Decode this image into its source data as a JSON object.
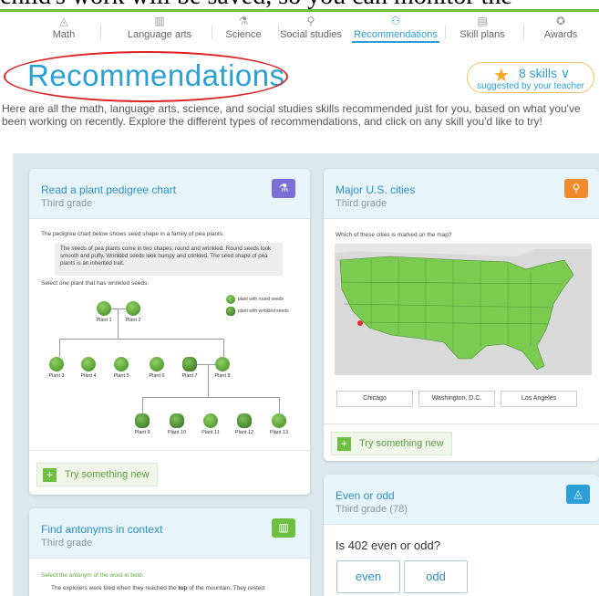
{
  "top_cut_text": "child's work will be saved, so you can monitor the",
  "nav": [
    {
      "label": "Math",
      "icon": "◬"
    },
    {
      "label": "Language arts",
      "icon": "▥"
    },
    {
      "label": "Science",
      "icon": "⚗"
    },
    {
      "label": "Social studies",
      "icon": "⚲"
    },
    {
      "label": "Recommendations",
      "icon": "⚇"
    },
    {
      "label": "Skill plans",
      "icon": "▤"
    },
    {
      "label": "Awards",
      "icon": "✪"
    }
  ],
  "page_title": "Recommendations",
  "skills_pill": {
    "count_label": "8 skills ∨",
    "sub": "suggested by your teacher"
  },
  "intro": "Here are all the math, language arts, science, and social studies skills recommended just for you, based on what you've been working on recently. Explore the different types of recommendations, and click on any skill you'd like to try!",
  "card1": {
    "title": "Read a plant pedigree chart",
    "grade": "Third grade",
    "badge_icon": "⚗",
    "badge_color": "#7b6fd6",
    "lead": "The pedigree chart below shows seed shape in a family of pea plants.",
    "box_text": "The seeds of pea plants come in two shapes: round and wrinkled. Round seeds look smooth and puffy. Wrinkled seeds look bumpy and crinkled. The seed shape of pea plants is an inherited trait.",
    "question": "Select one plant that has wrinkled seeds.",
    "legend_round": "plant with round seeds",
    "legend_wrinkled": "plant with wrinkled seeds",
    "plants": [
      {
        "label": "Plant 1"
      },
      {
        "label": "Plant 2"
      },
      {
        "label": "Plant 3"
      },
      {
        "label": "Plant 4"
      },
      {
        "label": "Plant 5"
      },
      {
        "label": "Plant 6"
      },
      {
        "label": "Plant 7"
      },
      {
        "label": "Plant 8"
      },
      {
        "label": "Plant 9"
      },
      {
        "label": "Plant 10"
      },
      {
        "label": "Plant 11"
      },
      {
        "label": "Plant 12"
      },
      {
        "label": "Plant 13"
      }
    ],
    "try_label": "Try something new"
  },
  "card2": {
    "title": "Major U.S. cities",
    "grade": "Third grade",
    "badge_icon": "⚲",
    "badge_color": "#f08a2c",
    "question": "Which of these cities is marked on the map?",
    "options": [
      "Chicago",
      "Washington, D.C.",
      "Los Angeles"
    ],
    "try_label": "Try something new"
  },
  "card3": {
    "title": "Find antonyms in context",
    "grade": "Third grade",
    "badge_icon": "▥",
    "badge_color": "#6cbf3f",
    "instruction": "Select the antonym of the word in bold.",
    "sentence_pre": "The explorers were tired when they reached the ",
    "sentence_bold": "top",
    "sentence_post": " of the mountain. They rested"
  },
  "card4": {
    "title": "Even or odd",
    "grade": "Third grade (78)",
    "badge_icon": "◬",
    "badge_color": "#2b9fd6",
    "question": "Is 402 even or odd?",
    "options": [
      "even",
      "odd"
    ]
  }
}
